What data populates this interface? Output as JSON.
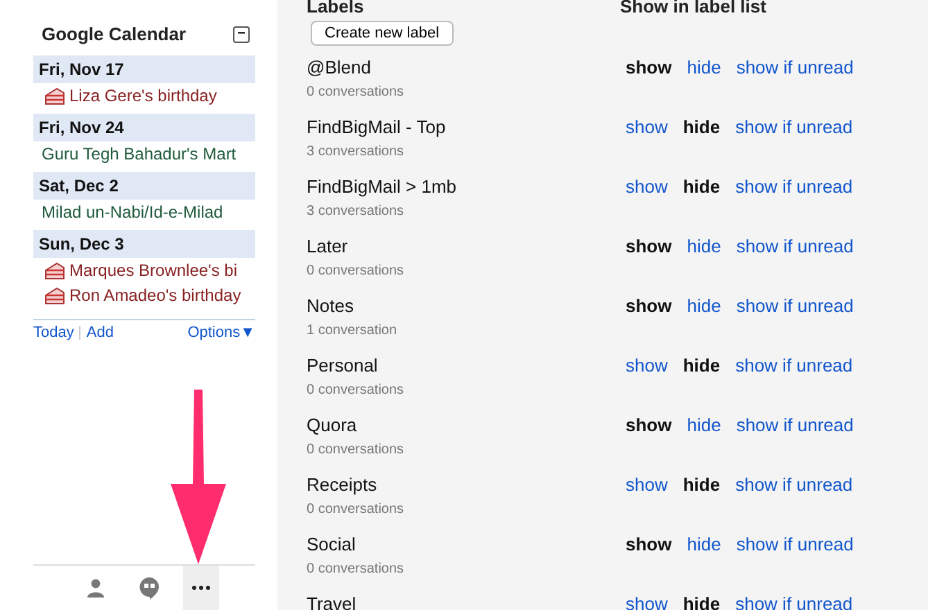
{
  "calendar": {
    "title": "Google Calendar",
    "collapse_symbol": "−",
    "days": [
      {
        "date": "Fri, Nov 17",
        "events": [
          {
            "kind": "birthday",
            "text": "Liza Gere's birthday"
          }
        ]
      },
      {
        "date": "Fri, Nov 24",
        "events": [
          {
            "kind": "holiday",
            "text": "Guru Tegh Bahadur's Mart"
          }
        ]
      },
      {
        "date": "Sat, Dec 2",
        "events": [
          {
            "kind": "holiday",
            "text": "Milad un-Nabi/Id-e-Milad"
          }
        ]
      },
      {
        "date": "Sun, Dec 3",
        "events": [
          {
            "kind": "birthday",
            "text": "Marques Brownlee's bi"
          },
          {
            "kind": "birthday",
            "text": "Ron Amadeo's birthday"
          }
        ]
      }
    ],
    "links": [
      "Today",
      "Add"
    ],
    "options": "Options▼"
  },
  "labels": {
    "heading": "Labels",
    "visibility_heading": "Show in label list",
    "create_button": "Create new label",
    "rows": [
      {
        "name": "@Blend",
        "count": "0 conversations",
        "options": [
          {
            "text": "show",
            "selected": true
          },
          {
            "text": "hide",
            "selected": false
          },
          {
            "text": "show if unread",
            "selected": false
          }
        ]
      },
      {
        "name": "FindBigMail - Top",
        "count": "3 conversations",
        "options": [
          {
            "text": "show",
            "selected": false
          },
          {
            "text": "hide",
            "selected": true
          },
          {
            "text": "show if unread",
            "selected": false
          }
        ]
      },
      {
        "name": "FindBigMail > 1mb",
        "count": "3 conversations",
        "options": [
          {
            "text": "show",
            "selected": false
          },
          {
            "text": "hide",
            "selected": true
          },
          {
            "text": "show if unread",
            "selected": false
          }
        ]
      },
      {
        "name": "Later",
        "count": "0 conversations",
        "options": [
          {
            "text": "show",
            "selected": true
          },
          {
            "text": "hide",
            "selected": false
          },
          {
            "text": "show if unread",
            "selected": false
          }
        ]
      },
      {
        "name": "Notes",
        "count": "1 conversation",
        "options": [
          {
            "text": "show",
            "selected": true
          },
          {
            "text": "hide",
            "selected": false
          },
          {
            "text": "show if unread",
            "selected": false
          }
        ]
      },
      {
        "name": "Personal",
        "count": "0 conversations",
        "options": [
          {
            "text": "show",
            "selected": false
          },
          {
            "text": "hide",
            "selected": true
          },
          {
            "text": "show if unread",
            "selected": false
          }
        ]
      },
      {
        "name": "Quora",
        "count": "0 conversations",
        "options": [
          {
            "text": "show",
            "selected": true
          },
          {
            "text": "hide",
            "selected": false
          },
          {
            "text": "show if unread",
            "selected": false
          }
        ]
      },
      {
        "name": "Receipts",
        "count": "0 conversations",
        "options": [
          {
            "text": "show",
            "selected": false
          },
          {
            "text": "hide",
            "selected": true
          },
          {
            "text": "show if unread",
            "selected": false
          }
        ]
      },
      {
        "name": "Social",
        "count": "0 conversations",
        "options": [
          {
            "text": "show",
            "selected": true
          },
          {
            "text": "hide",
            "selected": false
          },
          {
            "text": "show if unread",
            "selected": false
          }
        ]
      },
      {
        "name": "Travel",
        "options": [
          {
            "text": "show",
            "selected": false
          },
          {
            "text": "hide",
            "selected": true
          },
          {
            "text": "show if unread",
            "selected": false
          }
        ]
      }
    ]
  }
}
